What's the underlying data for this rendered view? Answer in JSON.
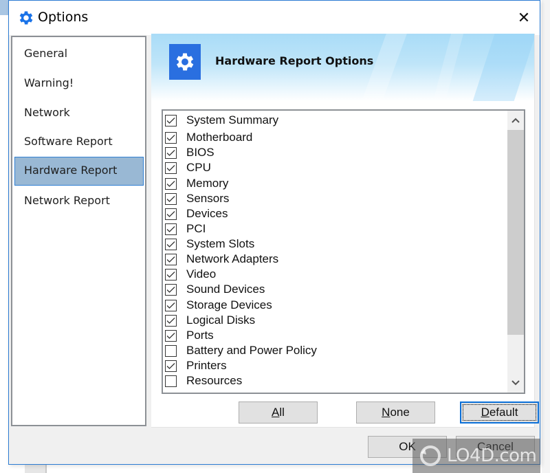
{
  "window": {
    "title": "Options",
    "icon": "gear-icon",
    "close_glyph": "✕"
  },
  "sidebar": {
    "items": [
      {
        "label": "General",
        "selected": false
      },
      {
        "label": "Warning!",
        "selected": false
      },
      {
        "label": "Network",
        "selected": false
      },
      {
        "label": "Software Report",
        "selected": false
      },
      {
        "label": "Hardware Report",
        "selected": true
      },
      {
        "label": "Network Report",
        "selected": false
      }
    ]
  },
  "header": {
    "title": "Hardware Report Options",
    "icon": "gear-icon"
  },
  "checklist": {
    "items": [
      {
        "label": "System Summary",
        "checked": true
      },
      {
        "label": "Motherboard",
        "checked": true
      },
      {
        "label": "BIOS",
        "checked": true
      },
      {
        "label": "CPU",
        "checked": true
      },
      {
        "label": "Memory",
        "checked": true
      },
      {
        "label": "Sensors",
        "checked": true
      },
      {
        "label": "Devices",
        "checked": true
      },
      {
        "label": "PCI",
        "checked": true
      },
      {
        "label": "System Slots",
        "checked": true
      },
      {
        "label": "Network Adapters",
        "checked": true
      },
      {
        "label": "Video",
        "checked": true
      },
      {
        "label": "Sound Devices",
        "checked": true
      },
      {
        "label": "Storage Devices",
        "checked": true
      },
      {
        "label": "Logical Disks",
        "checked": true
      },
      {
        "label": "Ports",
        "checked": true
      },
      {
        "label": "Battery and Power Policy",
        "checked": false
      },
      {
        "label": "Printers",
        "checked": true
      },
      {
        "label": "Resources",
        "checked": false
      }
    ]
  },
  "selection_buttons": {
    "all": {
      "mnemonic": "A",
      "rest": "ll"
    },
    "none": {
      "mnemonic": "N",
      "rest": "one"
    },
    "default": {
      "mnemonic": "D",
      "rest": "efault"
    }
  },
  "dialog_buttons": {
    "ok": "OK",
    "cancel": "Cancel"
  },
  "watermark": {
    "text": "LO4D.com"
  }
}
